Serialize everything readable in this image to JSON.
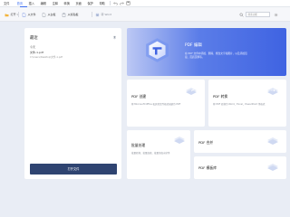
{
  "menu": {
    "items": [
      "文件",
      "首页",
      "插入",
      "编辑",
      "注释",
      "转换",
      "页面",
      "保护",
      "帮助"
    ],
    "active_index": 1
  },
  "toolbar": {
    "open": "打开",
    "new_from_file": "从文件",
    "blank": "从白板",
    "from_clipboard": "从剪贴板",
    "to_word": "转 Word",
    "search_placeholder": "搜索功能"
  },
  "recent": {
    "title": "最近",
    "today": "今天",
    "files": [
      {
        "name": "文件-1.pdf",
        "path": "C:\\Users\\Desktop\\文件-1.pdf"
      }
    ],
    "open_button": "打开文件"
  },
  "hero": {
    "title": "PDF 编辑",
    "desc": "在 PDF 文件中添加、删除、修改文字和图片，以及添加链接、页眉页脚等。"
  },
  "cards": {
    "create": {
      "title": "PDF 创建",
      "desc": "将 Microsoft Office 和其他文件格式创建为 PDF"
    },
    "convert": {
      "title": "PDF 转换",
      "desc": "将 PDF 转换为 Word、Excel、PowerPoint 等格式"
    },
    "batch": {
      "title": "批量处理",
      "desc": "批量转换、批量加密、批量添加水印等"
    },
    "merge": {
      "title": "PDF 合并"
    },
    "template": {
      "title": "PDF 模板库"
    }
  },
  "colors": {
    "accent": "#3d6ef0",
    "primary_button": "#2f4471",
    "hero_start": "#bcc8f4",
    "hero_end": "#3f63e2",
    "background": "#e9edf5"
  },
  "icons": [
    "open-folder-icon",
    "file-icon",
    "blank-page-icon",
    "clipboard-icon",
    "word-icon",
    "search-icon",
    "gear-icon",
    "pdf-logo-icon",
    "doc-stack-icon"
  ]
}
